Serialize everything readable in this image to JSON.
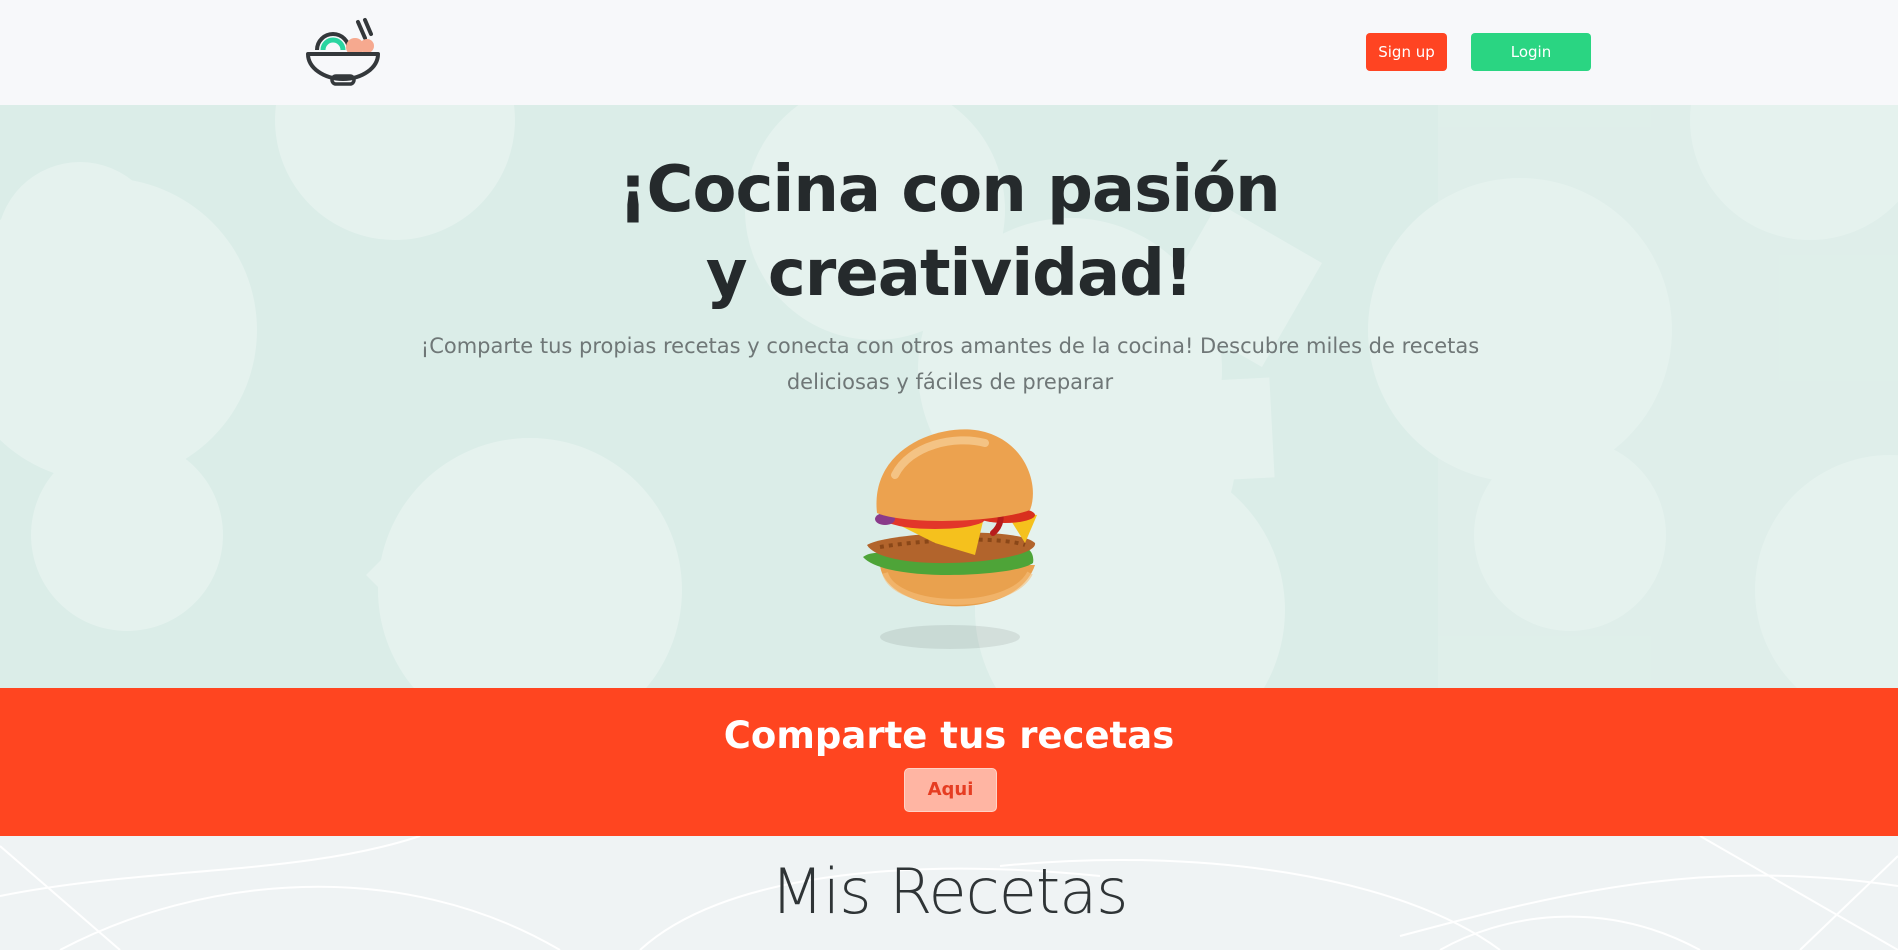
{
  "header": {
    "logo_icon": "bowl-with-chopsticks-icon",
    "signup_label": "Sign up",
    "login_label": "Login"
  },
  "hero": {
    "title_line1": "¡Cocina con pasión",
    "title_line2": "y creatividad!",
    "subtitle": "¡Comparte tus propias recetas y conecta con otros amantes de la cocina! Descubre miles de recetas deliciosas y fáciles de preparar",
    "image_icon": "burger-icon"
  },
  "cta": {
    "title": "Comparte tus recetas",
    "button_label": "Aqui"
  },
  "recipes": {
    "title": "Mis Recetas"
  },
  "colors": {
    "signup": "#ff4422",
    "login": "#2ad582",
    "cta_band": "#ff4520",
    "hero_bg": "#dbede8"
  }
}
